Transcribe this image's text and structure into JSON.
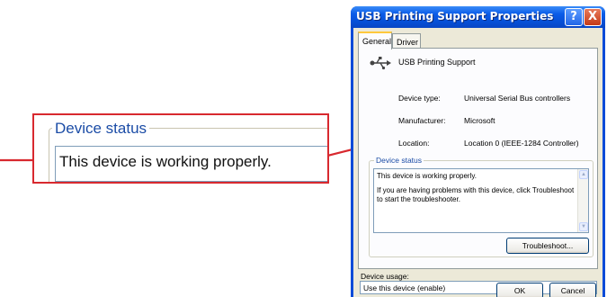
{
  "callout": {
    "legend": "Device status",
    "text": "This device is working properly."
  },
  "dialog": {
    "title": "USB Printing Support Properties",
    "help_glyph": "?",
    "close_glyph": "X",
    "tabs": [
      {
        "label": "General",
        "active": true
      },
      {
        "label": "Driver",
        "active": false
      }
    ],
    "device_name": "USB Printing Support",
    "properties": [
      {
        "label": "Device type:",
        "value": "Universal Serial Bus controllers"
      },
      {
        "label": "Manufacturer:",
        "value": "Microsoft"
      },
      {
        "label": "Location:",
        "value": "Location 0 (IEEE-1284 Controller)"
      }
    ],
    "status": {
      "legend": "Device status",
      "line1": "This device is working properly.",
      "line2": "If you are having problems with this device, click Troubleshoot to start the troubleshooter."
    },
    "troubleshoot_label": "Troubleshoot...",
    "usage_label": "Device usage:",
    "usage_value": "Use this device (enable)",
    "ok_label": "OK",
    "cancel_label": "Cancel"
  },
  "colors": {
    "callout_border": "#d8292f",
    "xp_title_blue": "#0a5ce8",
    "dialog_face": "#ece9d8",
    "legend_blue": "#1b4ca6"
  },
  "icons": [
    "arrow-right-icon",
    "usb-icon",
    "help-icon",
    "close-icon",
    "scroll-up-icon",
    "scroll-down-icon",
    "dropdown-arrow-icon"
  ]
}
